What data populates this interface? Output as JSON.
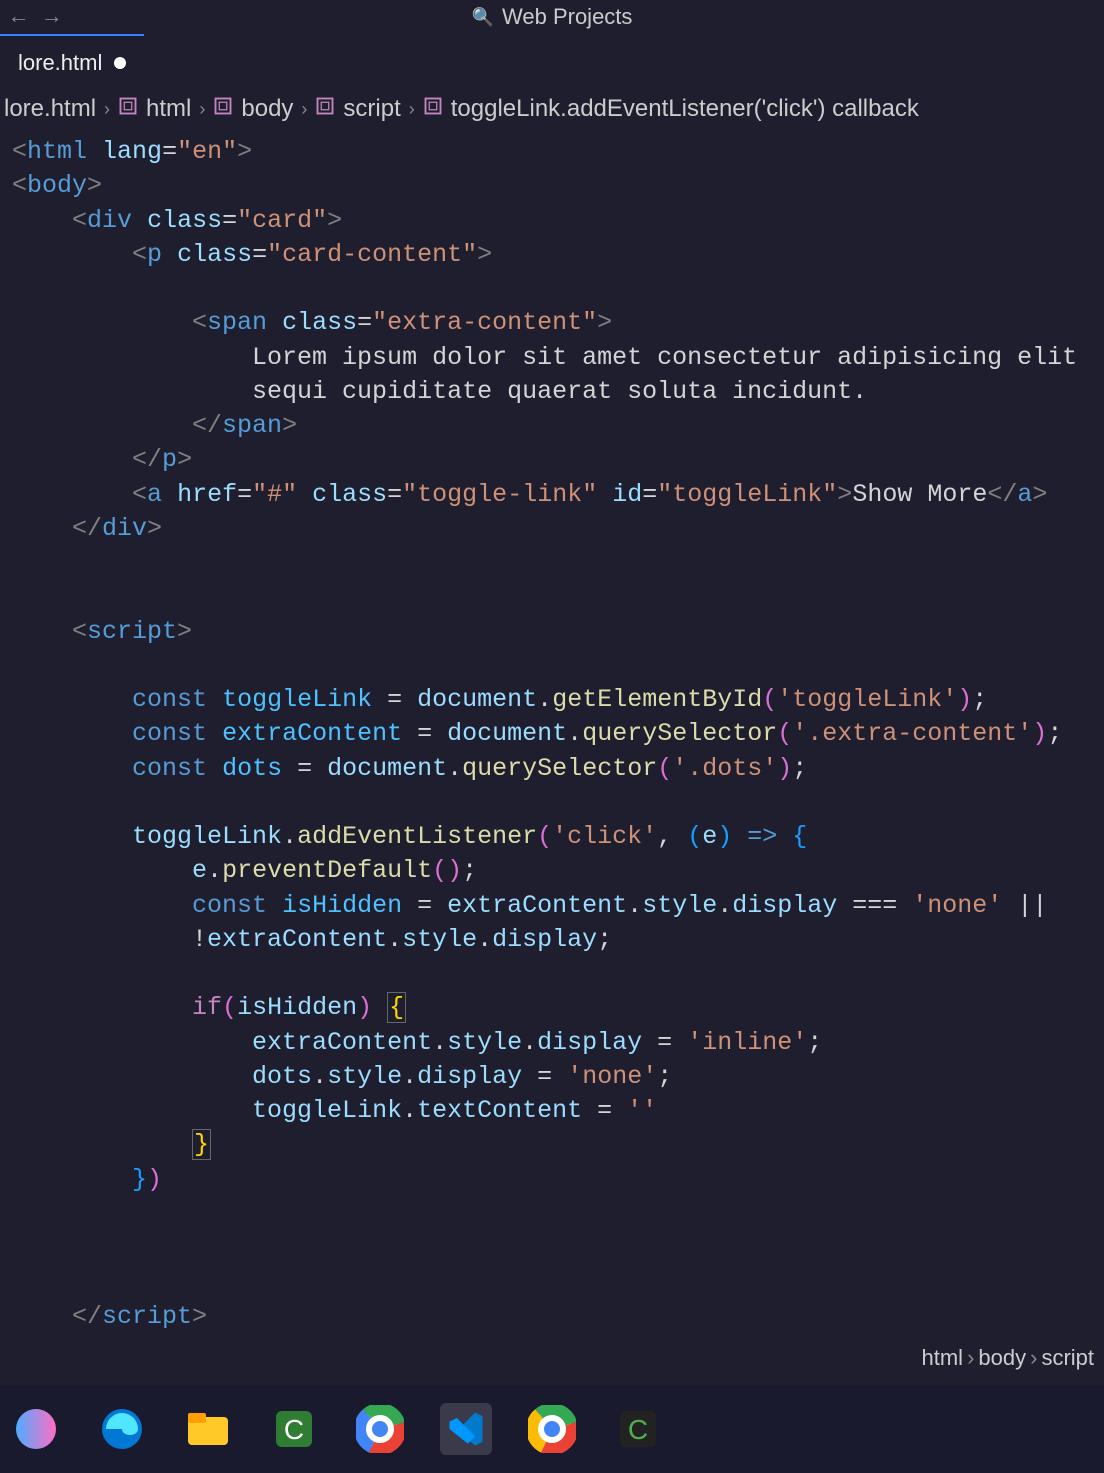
{
  "titlebar": {
    "search_text": "Web Projects"
  },
  "tab": {
    "name": "lore.html"
  },
  "breadcrumbs": [
    {
      "type": "file",
      "label": "lore.html"
    },
    {
      "type": "symbol",
      "label": "html"
    },
    {
      "type": "symbol",
      "label": "body"
    },
    {
      "type": "symbol",
      "label": "script"
    },
    {
      "type": "symbol",
      "label": "toggleLink.addEventListener('click') callback"
    }
  ],
  "code_lines": [
    [
      {
        "cls": "t-brk",
        "t": "<"
      },
      {
        "cls": "t-tag",
        "t": "html"
      },
      {
        "cls": "t-txt",
        "t": " "
      },
      {
        "cls": "t-attr",
        "t": "lang"
      },
      {
        "cls": "t-op",
        "t": "="
      },
      {
        "cls": "t-str",
        "t": "\"en\""
      },
      {
        "cls": "t-brk",
        "t": ">"
      }
    ],
    [
      {
        "cls": "t-brk",
        "t": "<"
      },
      {
        "cls": "t-tag",
        "t": "body"
      },
      {
        "cls": "t-brk",
        "t": ">"
      }
    ],
    [
      {
        "cls": "t-txt",
        "t": "    "
      },
      {
        "cls": "t-brk",
        "t": "<"
      },
      {
        "cls": "t-tag",
        "t": "div"
      },
      {
        "cls": "t-txt",
        "t": " "
      },
      {
        "cls": "t-attr",
        "t": "class"
      },
      {
        "cls": "t-op",
        "t": "="
      },
      {
        "cls": "t-str",
        "t": "\"card\""
      },
      {
        "cls": "t-brk",
        "t": ">"
      }
    ],
    [
      {
        "cls": "t-txt",
        "t": "        "
      },
      {
        "cls": "t-brk",
        "t": "<"
      },
      {
        "cls": "t-tag",
        "t": "p"
      },
      {
        "cls": "t-txt",
        "t": " "
      },
      {
        "cls": "t-attr",
        "t": "class"
      },
      {
        "cls": "t-op",
        "t": "="
      },
      {
        "cls": "t-str",
        "t": "\"card-content\""
      },
      {
        "cls": "t-brk",
        "t": ">"
      }
    ],
    [
      {
        "cls": "t-txt",
        "t": ""
      }
    ],
    [
      {
        "cls": "t-txt",
        "t": "            "
      },
      {
        "cls": "t-brk",
        "t": "<"
      },
      {
        "cls": "t-tag",
        "t": "span"
      },
      {
        "cls": "t-txt",
        "t": " "
      },
      {
        "cls": "t-attr",
        "t": "class"
      },
      {
        "cls": "t-op",
        "t": "="
      },
      {
        "cls": "t-str",
        "t": "\"extra-content\""
      },
      {
        "cls": "t-brk",
        "t": ">"
      }
    ],
    [
      {
        "cls": "t-txt",
        "t": "                Lorem ipsum dolor sit amet consectetur adipisicing elit"
      }
    ],
    [
      {
        "cls": "t-txt",
        "t": "                sequi cupiditate quaerat soluta incidunt."
      }
    ],
    [
      {
        "cls": "t-txt",
        "t": "            "
      },
      {
        "cls": "t-brk",
        "t": "</"
      },
      {
        "cls": "t-tag",
        "t": "span"
      },
      {
        "cls": "t-brk",
        "t": ">"
      }
    ],
    [
      {
        "cls": "t-txt",
        "t": "        "
      },
      {
        "cls": "t-brk",
        "t": "</"
      },
      {
        "cls": "t-tag",
        "t": "p"
      },
      {
        "cls": "t-brk",
        "t": ">"
      }
    ],
    [
      {
        "cls": "t-txt",
        "t": "        "
      },
      {
        "cls": "t-brk",
        "t": "<"
      },
      {
        "cls": "t-tag",
        "t": "a"
      },
      {
        "cls": "t-txt",
        "t": " "
      },
      {
        "cls": "t-attr",
        "t": "href"
      },
      {
        "cls": "t-op",
        "t": "="
      },
      {
        "cls": "t-str",
        "t": "\"#\""
      },
      {
        "cls": "t-txt",
        "t": " "
      },
      {
        "cls": "t-attr",
        "t": "class"
      },
      {
        "cls": "t-op",
        "t": "="
      },
      {
        "cls": "t-str",
        "t": "\"toggle-link\""
      },
      {
        "cls": "t-txt",
        "t": " "
      },
      {
        "cls": "t-attr",
        "t": "id"
      },
      {
        "cls": "t-op",
        "t": "="
      },
      {
        "cls": "t-str",
        "t": "\"toggleLink\""
      },
      {
        "cls": "t-brk",
        "t": ">"
      },
      {
        "cls": "t-txt",
        "t": "Show More"
      },
      {
        "cls": "t-brk",
        "t": "</"
      },
      {
        "cls": "t-tag",
        "t": "a"
      },
      {
        "cls": "t-brk",
        "t": ">"
      }
    ],
    [
      {
        "cls": "t-txt",
        "t": "    "
      },
      {
        "cls": "t-brk",
        "t": "</"
      },
      {
        "cls": "t-tag",
        "t": "div"
      },
      {
        "cls": "t-brk",
        "t": ">"
      }
    ],
    [
      {
        "cls": "t-txt",
        "t": ""
      }
    ],
    [
      {
        "cls": "t-txt",
        "t": ""
      }
    ],
    [
      {
        "cls": "t-txt",
        "t": "    "
      },
      {
        "cls": "t-brk",
        "t": "<"
      },
      {
        "cls": "t-tag",
        "t": "script"
      },
      {
        "cls": "t-brk",
        "t": ">"
      }
    ],
    [
      {
        "cls": "t-txt",
        "t": ""
      }
    ],
    [
      {
        "cls": "t-txt",
        "t": "        "
      },
      {
        "cls": "t-kw",
        "t": "const"
      },
      {
        "cls": "t-txt",
        "t": " "
      },
      {
        "cls": "t-gvar",
        "t": "toggleLink"
      },
      {
        "cls": "t-txt",
        "t": " "
      },
      {
        "cls": "t-op",
        "t": "="
      },
      {
        "cls": "t-txt",
        "t": " "
      },
      {
        "cls": "t-var",
        "t": "document"
      },
      {
        "cls": "t-dot",
        "t": "."
      },
      {
        "cls": "t-fn",
        "t": "getElementById"
      },
      {
        "cls": "t-par",
        "t": "("
      },
      {
        "cls": "t-str",
        "t": "'toggleLink'"
      },
      {
        "cls": "t-par",
        "t": ")"
      },
      {
        "cls": "t-txt",
        "t": ";"
      }
    ],
    [
      {
        "cls": "t-txt",
        "t": "        "
      },
      {
        "cls": "t-kw",
        "t": "const"
      },
      {
        "cls": "t-txt",
        "t": " "
      },
      {
        "cls": "t-gvar",
        "t": "extraContent"
      },
      {
        "cls": "t-txt",
        "t": " "
      },
      {
        "cls": "t-op",
        "t": "="
      },
      {
        "cls": "t-txt",
        "t": " "
      },
      {
        "cls": "t-var",
        "t": "document"
      },
      {
        "cls": "t-dot",
        "t": "."
      },
      {
        "cls": "t-fn",
        "t": "querySelector"
      },
      {
        "cls": "t-par",
        "t": "("
      },
      {
        "cls": "t-str",
        "t": "'.extra-content'"
      },
      {
        "cls": "t-par",
        "t": ")"
      },
      {
        "cls": "t-txt",
        "t": ";"
      }
    ],
    [
      {
        "cls": "t-txt",
        "t": "        "
      },
      {
        "cls": "t-kw",
        "t": "const"
      },
      {
        "cls": "t-txt",
        "t": " "
      },
      {
        "cls": "t-gvar",
        "t": "dots"
      },
      {
        "cls": "t-txt",
        "t": " "
      },
      {
        "cls": "t-op",
        "t": "="
      },
      {
        "cls": "t-txt",
        "t": " "
      },
      {
        "cls": "t-var",
        "t": "document"
      },
      {
        "cls": "t-dot",
        "t": "."
      },
      {
        "cls": "t-fn",
        "t": "querySelector"
      },
      {
        "cls": "t-par",
        "t": "("
      },
      {
        "cls": "t-str",
        "t": "'.dots'"
      },
      {
        "cls": "t-par",
        "t": ")"
      },
      {
        "cls": "t-txt",
        "t": ";"
      }
    ],
    [
      {
        "cls": "t-txt",
        "t": ""
      }
    ],
    [
      {
        "cls": "t-txt",
        "t": "        "
      },
      {
        "cls": "t-var",
        "t": "toggleLink"
      },
      {
        "cls": "t-dot",
        "t": "."
      },
      {
        "cls": "t-fn",
        "t": "addEventListener"
      },
      {
        "cls": "t-par",
        "t": "("
      },
      {
        "cls": "t-str",
        "t": "'click'"
      },
      {
        "cls": "t-txt",
        "t": ", "
      },
      {
        "cls": "t-par2",
        "t": "("
      },
      {
        "cls": "t-var",
        "t": "e"
      },
      {
        "cls": "t-par2",
        "t": ")"
      },
      {
        "cls": "t-txt",
        "t": " "
      },
      {
        "cls": "t-kw",
        "t": "=>"
      },
      {
        "cls": "t-txt",
        "t": " "
      },
      {
        "cls": "t-par2",
        "t": "{"
      }
    ],
    [
      {
        "cls": "t-txt",
        "t": "            "
      },
      {
        "cls": "t-var",
        "t": "e"
      },
      {
        "cls": "t-dot",
        "t": "."
      },
      {
        "cls": "t-fn",
        "t": "preventDefault"
      },
      {
        "cls": "t-par",
        "t": "("
      },
      {
        "cls": "t-par",
        "t": ")"
      },
      {
        "cls": "t-txt",
        "t": ";"
      }
    ],
    [
      {
        "cls": "t-txt",
        "t": "            "
      },
      {
        "cls": "t-kw",
        "t": "const"
      },
      {
        "cls": "t-txt",
        "t": " "
      },
      {
        "cls": "t-gvar",
        "t": "isHidden"
      },
      {
        "cls": "t-txt",
        "t": " "
      },
      {
        "cls": "t-op",
        "t": "="
      },
      {
        "cls": "t-txt",
        "t": " "
      },
      {
        "cls": "t-var",
        "t": "extraContent"
      },
      {
        "cls": "t-dot",
        "t": "."
      },
      {
        "cls": "t-var",
        "t": "style"
      },
      {
        "cls": "t-dot",
        "t": "."
      },
      {
        "cls": "t-var",
        "t": "display"
      },
      {
        "cls": "t-txt",
        "t": " "
      },
      {
        "cls": "t-op",
        "t": "==="
      },
      {
        "cls": "t-txt",
        "t": " "
      },
      {
        "cls": "t-str",
        "t": "'none'"
      },
      {
        "cls": "t-txt",
        "t": " "
      },
      {
        "cls": "t-op",
        "t": "||"
      }
    ],
    [
      {
        "cls": "t-txt",
        "t": "            "
      },
      {
        "cls": "t-op",
        "t": "!"
      },
      {
        "cls": "t-var",
        "t": "extraContent"
      },
      {
        "cls": "t-dot",
        "t": "."
      },
      {
        "cls": "t-var",
        "t": "style"
      },
      {
        "cls": "t-dot",
        "t": "."
      },
      {
        "cls": "t-var",
        "t": "display"
      },
      {
        "cls": "t-txt",
        "t": ";"
      }
    ],
    [
      {
        "cls": "t-txt",
        "t": ""
      }
    ],
    [
      {
        "cls": "t-txt",
        "t": "            "
      },
      {
        "cls": "t-kw2",
        "t": "if"
      },
      {
        "cls": "t-par",
        "t": "("
      },
      {
        "cls": "t-var",
        "t": "isHidden"
      },
      {
        "cls": "t-par",
        "t": ")"
      },
      {
        "cls": "t-txt",
        "t": " "
      },
      {
        "cls": "t-match",
        "t": "{"
      }
    ],
    [
      {
        "cls": "t-txt",
        "t": "                "
      },
      {
        "cls": "t-var",
        "t": "extraContent"
      },
      {
        "cls": "t-dot",
        "t": "."
      },
      {
        "cls": "t-var",
        "t": "style"
      },
      {
        "cls": "t-dot",
        "t": "."
      },
      {
        "cls": "t-var",
        "t": "display"
      },
      {
        "cls": "t-txt",
        "t": " "
      },
      {
        "cls": "t-op",
        "t": "="
      },
      {
        "cls": "t-txt",
        "t": " "
      },
      {
        "cls": "t-str",
        "t": "'inline'"
      },
      {
        "cls": "t-txt",
        "t": ";"
      }
    ],
    [
      {
        "cls": "t-txt",
        "t": "                "
      },
      {
        "cls": "t-var",
        "t": "dots"
      },
      {
        "cls": "t-dot",
        "t": "."
      },
      {
        "cls": "t-var",
        "t": "style"
      },
      {
        "cls": "t-dot",
        "t": "."
      },
      {
        "cls": "t-var",
        "t": "display"
      },
      {
        "cls": "t-txt",
        "t": " "
      },
      {
        "cls": "t-op",
        "t": "="
      },
      {
        "cls": "t-txt",
        "t": " "
      },
      {
        "cls": "t-str",
        "t": "'none'"
      },
      {
        "cls": "t-txt",
        "t": ";"
      }
    ],
    [
      {
        "cls": "t-txt",
        "t": "                "
      },
      {
        "cls": "t-var",
        "t": "toggleLink"
      },
      {
        "cls": "t-dot",
        "t": "."
      },
      {
        "cls": "t-var",
        "t": "textContent"
      },
      {
        "cls": "t-txt",
        "t": " "
      },
      {
        "cls": "t-op",
        "t": "="
      },
      {
        "cls": "t-txt",
        "t": " "
      },
      {
        "cls": "t-str",
        "t": "''"
      }
    ],
    [
      {
        "cls": "t-txt",
        "t": "            "
      },
      {
        "cls": "t-match",
        "t": "}"
      }
    ],
    [
      {
        "cls": "t-txt",
        "t": "        "
      },
      {
        "cls": "t-par2",
        "t": "}"
      },
      {
        "cls": "t-par",
        "t": ")"
      }
    ],
    [
      {
        "cls": "t-txt",
        "t": ""
      }
    ],
    [
      {
        "cls": "t-txt",
        "t": ""
      }
    ],
    [
      {
        "cls": "t-txt",
        "t": ""
      }
    ],
    [
      {
        "cls": "t-txt",
        "t": "    "
      },
      {
        "cls": "t-brk",
        "t": "</"
      },
      {
        "cls": "t-tag",
        "t": "script"
      },
      {
        "cls": "t-brk",
        "t": ">"
      }
    ]
  ],
  "statusbar": {
    "path": [
      "html",
      "body",
      "script"
    ]
  },
  "taskbar_icons": [
    "copilot",
    "edge",
    "explorer",
    "camtasia",
    "chrome",
    "vscode",
    "chrome2",
    "camtasia2"
  ]
}
